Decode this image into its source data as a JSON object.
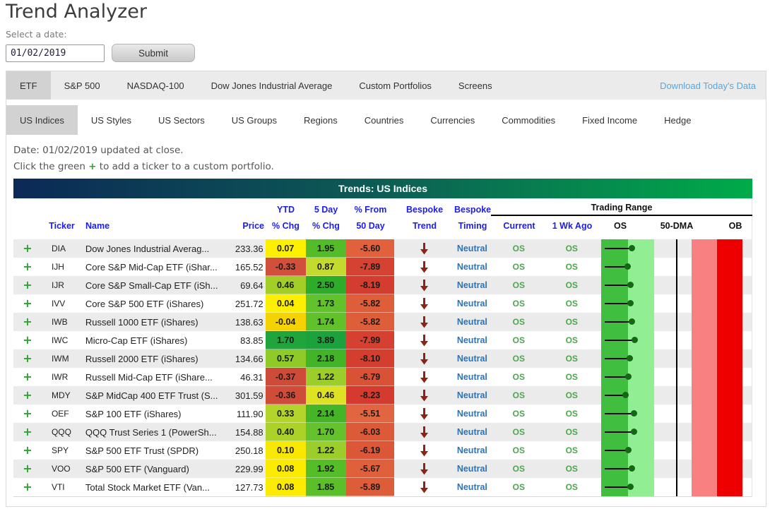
{
  "page": {
    "title": "Trend Analyzer",
    "date_label": "Select a date:",
    "date_value": "01/02/2019",
    "submit_label": "Submit"
  },
  "nav": {
    "primary_tabs": [
      {
        "label": "ETF",
        "active": true
      },
      {
        "label": "S&P 500",
        "active": false
      },
      {
        "label": "NASDAQ-100",
        "active": false
      },
      {
        "label": "Dow Jones Industrial Average",
        "active": false
      },
      {
        "label": "Custom Portfolios",
        "active": false
      },
      {
        "label": "Screens",
        "active": false
      }
    ],
    "download_link": "Download Today's Data",
    "secondary_tabs": [
      {
        "label": "US Indices",
        "active": true
      },
      {
        "label": "US Styles",
        "active": false
      },
      {
        "label": "US Sectors",
        "active": false
      },
      {
        "label": "US Groups",
        "active": false
      },
      {
        "label": "Regions",
        "active": false
      },
      {
        "label": "Countries",
        "active": false
      },
      {
        "label": "Currencies",
        "active": false
      },
      {
        "label": "Commodities",
        "active": false
      },
      {
        "label": "Fixed Income",
        "active": false
      },
      {
        "label": "Hedge",
        "active": false
      }
    ]
  },
  "info": {
    "date_line": "Date: 01/02/2019 updated at close.",
    "hint_prefix": "Click the green ",
    "hint_plus": "+",
    "hint_suffix": " to add a ticker to a custom portfolio."
  },
  "table": {
    "title": "Trends: US Indices",
    "headers": {
      "ticker": "Ticker",
      "name": "Name",
      "price": "Price",
      "ytd_top": "YTD",
      "ytd_bot": "% Chg",
      "d5_top": "5 Day",
      "d5_bot": "% Chg",
      "p50_top": "% From",
      "p50_bot": "50 Day",
      "trend_top": "Bespoke",
      "trend_bot": "Trend",
      "timing_top": "Bespoke",
      "timing_bot": "Timing",
      "range_group": "Trading Range",
      "current": "Current",
      "wk_ago": "1 Wk Ago",
      "os": "OS",
      "dma": "50-DMA",
      "ob": "OB"
    },
    "trading_range_colors": {
      "oversold_dark": "#3FBE3F",
      "oversold_light": "#92EE92",
      "overbought_light": "#F98080",
      "overbought_red": "#EE0000",
      "dma_line": "#000000",
      "dot": "#156615"
    },
    "rows": [
      {
        "ticker": "DIA",
        "name": "Dow Jones Industrial Averag...",
        "price": "233.36",
        "ytd": {
          "v": "0.07",
          "bg": "#FCEF00"
        },
        "d5": {
          "v": "1.95",
          "bg": "#53BC28"
        },
        "p50": {
          "v": "-5.60",
          "bg": "#E0613C"
        },
        "trend": "down",
        "timing": "Neutral",
        "current": "OS",
        "wk_ago": "OS",
        "dot_pct": 21.5
      },
      {
        "ticker": "IJH",
        "name": "Core S&P Mid-Cap ETF (iShar...",
        "price": "165.52",
        "ytd": {
          "v": "-0.33",
          "bg": "#D0503B"
        },
        "d5": {
          "v": "0.87",
          "bg": "#C3DA2E"
        },
        "p50": {
          "v": "-7.89",
          "bg": "#D64231"
        },
        "trend": "down",
        "timing": "Neutral",
        "current": "OS",
        "wk_ago": "OS",
        "dot_pct": 18.5
      },
      {
        "ticker": "IJR",
        "name": "Core S&P Small-Cap ETF (iSh...",
        "price": "69.64",
        "ytd": {
          "v": "0.46",
          "bg": "#A3CE28"
        },
        "d5": {
          "v": "2.50",
          "bg": "#2EAC29"
        },
        "p50": {
          "v": "-8.19",
          "bg": "#D43C2F"
        },
        "trend": "down",
        "timing": "Neutral",
        "current": "OS",
        "wk_ago": "OS",
        "dot_pct": 20.5
      },
      {
        "ticker": "IVV",
        "name": "Core S&P 500 ETF (iShares)",
        "price": "251.72",
        "ytd": {
          "v": "0.04",
          "bg": "#FCEF00"
        },
        "d5": {
          "v": "1.73",
          "bg": "#61C22B"
        },
        "p50": {
          "v": "-5.82",
          "bg": "#DF5E3A"
        },
        "trend": "down",
        "timing": "Neutral",
        "current": "OS",
        "wk_ago": "OS",
        "dot_pct": 20.5
      },
      {
        "ticker": "IWB",
        "name": "Russell 1000 ETF (iShares)",
        "price": "138.63",
        "ytd": {
          "v": "-0.04",
          "bg": "#F5D201"
        },
        "d5": {
          "v": "1.74",
          "bg": "#60C12B"
        },
        "p50": {
          "v": "-5.82",
          "bg": "#DF5E3A"
        },
        "trend": "down",
        "timing": "Neutral",
        "current": "OS",
        "wk_ago": "OS",
        "dot_pct": 21.5
      },
      {
        "ticker": "IWC",
        "name": "Micro-Cap ETF (iShares)",
        "price": "83.85",
        "ytd": {
          "v": "1.70",
          "bg": "#1FA53B"
        },
        "d5": {
          "v": "3.89",
          "bg": "#1BA23C"
        },
        "p50": {
          "v": "-7.99",
          "bg": "#D54030"
        },
        "trend": "down",
        "timing": "Neutral",
        "current": "OS",
        "wk_ago": "OS",
        "dot_pct": 23.5
      },
      {
        "ticker": "IWM",
        "name": "Russell 2000 ETF (iShares)",
        "price": "134.66",
        "ytd": {
          "v": "0.57",
          "bg": "#90CA29"
        },
        "d5": {
          "v": "2.18",
          "bg": "#42B427"
        },
        "p50": {
          "v": "-8.10",
          "bg": "#D43E2F"
        },
        "trend": "down",
        "timing": "Neutral",
        "current": "OS",
        "wk_ago": "OS",
        "dot_pct": 20
      },
      {
        "ticker": "IWR",
        "name": "Russell Mid-Cap ETF (iShare...",
        "price": "46.31",
        "ytd": {
          "v": "-0.37",
          "bg": "#CF4B39"
        },
        "d5": {
          "v": "1.22",
          "bg": "#9BCD2B"
        },
        "p50": {
          "v": "-6.79",
          "bg": "#DA5236"
        },
        "trend": "down",
        "timing": "Neutral",
        "current": "OS",
        "wk_ago": "OS",
        "dot_pct": 19
      },
      {
        "ticker": "MDY",
        "name": "S&P MidCap 400 ETF Trust (S...",
        "price": "301.59",
        "ytd": {
          "v": "-0.36",
          "bg": "#CF4C39"
        },
        "d5": {
          "v": "0.46",
          "bg": "#DFE223"
        },
        "p50": {
          "v": "-8.23",
          "bg": "#D43B2E"
        },
        "trend": "down",
        "timing": "Neutral",
        "current": "OS",
        "wk_ago": "OS",
        "dot_pct": 17
      },
      {
        "ticker": "OEF",
        "name": "S&P 100 ETF (iShares)",
        "price": "111.90",
        "ytd": {
          "v": "0.33",
          "bg": "#B3D42B"
        },
        "d5": {
          "v": "2.14",
          "bg": "#45B527"
        },
        "p50": {
          "v": "-5.51",
          "bg": "#E16540"
        },
        "trend": "down",
        "timing": "Neutral",
        "current": "OS",
        "wk_ago": "OS",
        "dot_pct": 23
      },
      {
        "ticker": "QQQ",
        "name": "QQQ Trust Series 1 (PowerSh...",
        "price": "154.88",
        "ytd": {
          "v": "0.40",
          "bg": "#ABD229"
        },
        "d5": {
          "v": "1.70",
          "bg": "#64C32C"
        },
        "p50": {
          "v": "-6.03",
          "bg": "#DD5A39"
        },
        "trend": "down",
        "timing": "Neutral",
        "current": "OS",
        "wk_ago": "OS",
        "dot_pct": 23
      },
      {
        "ticker": "SPY",
        "name": "S&P 500 ETF Trust (SPDR)",
        "price": "250.18",
        "ytd": {
          "v": "0.10",
          "bg": "#F7E701"
        },
        "d5": {
          "v": "1.22",
          "bg": "#9BCD2B"
        },
        "p50": {
          "v": "-6.19",
          "bg": "#DC5738"
        },
        "trend": "down",
        "timing": "Neutral",
        "current": "OS",
        "wk_ago": "OS",
        "dot_pct": 19
      },
      {
        "ticker": "VOO",
        "name": "S&P 500 ETF (Vanguard)",
        "price": "229.99",
        "ytd": {
          "v": "0.08",
          "bg": "#FAEB00"
        },
        "d5": {
          "v": "1.92",
          "bg": "#54BD28"
        },
        "p50": {
          "v": "-5.67",
          "bg": "#E0603B"
        },
        "trend": "down",
        "timing": "Neutral",
        "current": "OS",
        "wk_ago": "OS",
        "dot_pct": 21.5
      },
      {
        "ticker": "VTI",
        "name": "Total Stock Market ETF (Van...",
        "price": "127.73",
        "ytd": {
          "v": "0.08",
          "bg": "#FAEB00"
        },
        "d5": {
          "v": "1.85",
          "bg": "#5ABF29"
        },
        "p50": {
          "v": "-5.89",
          "bg": "#DE5D39"
        },
        "trend": "down",
        "timing": "Neutral",
        "current": "OS",
        "wk_ago": "OS",
        "dot_pct": 20.5
      }
    ]
  },
  "colors": {
    "header_text_blue": "#1C1CF0",
    "timing_blue": "#2E74B5",
    "os_text_green": "#4DA64D",
    "plus_green": "#2BA52B",
    "trend_arrow_red": "#8B2318",
    "title_bar_gradient": [
      "#0B2956",
      "#00AB49"
    ],
    "active_tab_bg": "#D2D2D2",
    "strip_bg": "#EBEBEB",
    "row_stripe": "#EBEBEB",
    "download_link_blue": "#55A7E6"
  }
}
